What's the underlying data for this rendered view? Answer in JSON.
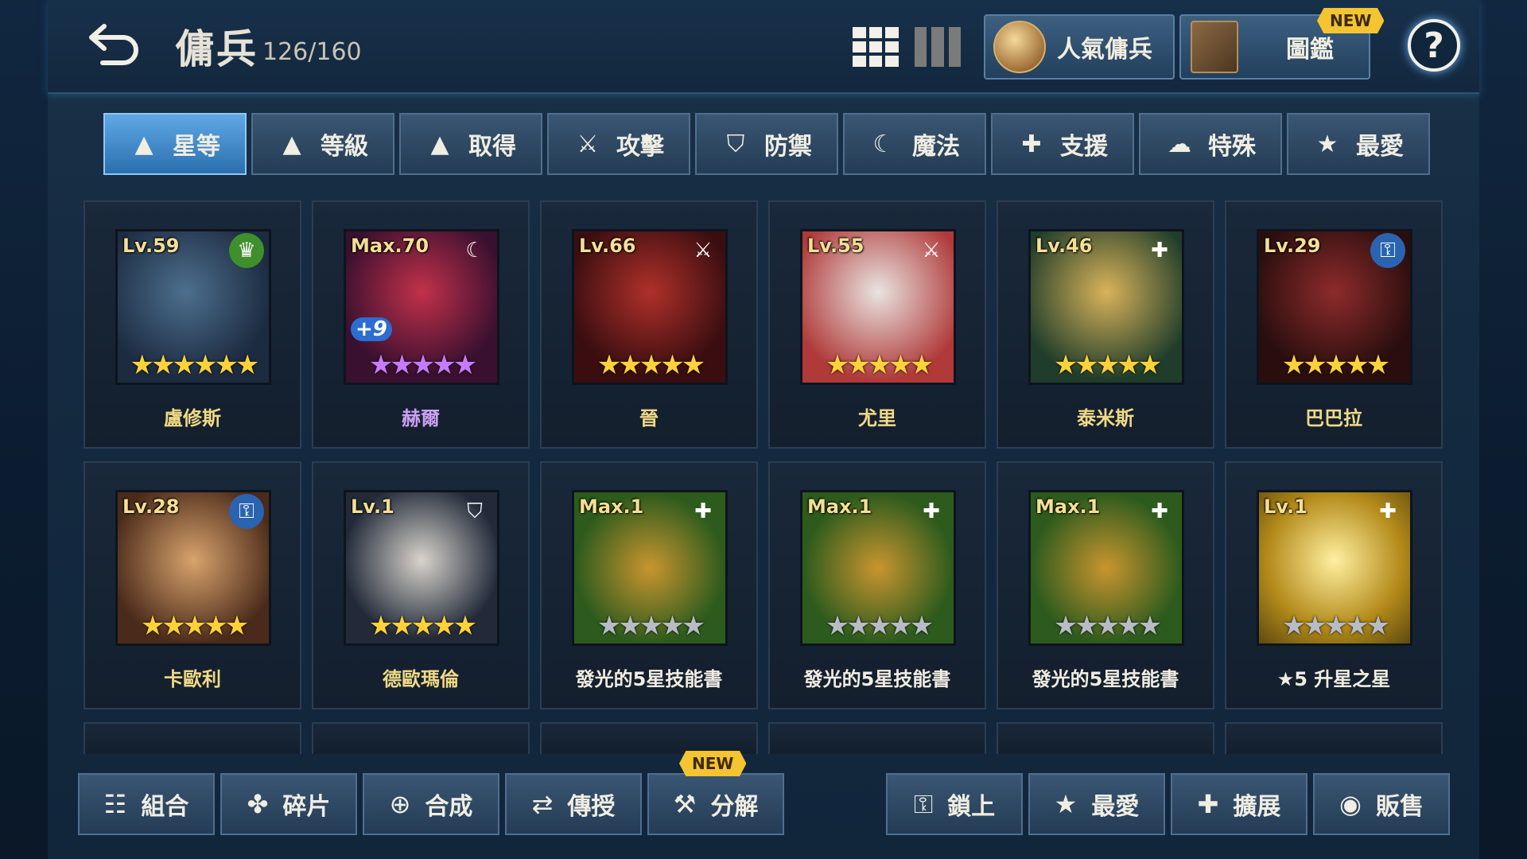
{
  "header": {
    "title": "傭兵",
    "count": "126/160",
    "popular_label": "人氣傭兵",
    "dex_label": "圖鑑",
    "dex_badge": "NEW"
  },
  "sort_tabs": [
    {
      "label": "星等",
      "icon": "arrow-up-icon",
      "active": true
    },
    {
      "label": "等級",
      "icon": "arrow-up-icon"
    },
    {
      "label": "取得",
      "icon": "arrow-up-icon"
    },
    {
      "label": "攻擊",
      "icon": "sword-icon"
    },
    {
      "label": "防禦",
      "icon": "shield-icon"
    },
    {
      "label": "魔法",
      "icon": "magic-icon"
    },
    {
      "label": "支援",
      "icon": "support-icon"
    },
    {
      "label": "特殊",
      "icon": "special-icon"
    },
    {
      "label": "最愛",
      "icon": "star-icon"
    }
  ],
  "units": [
    {
      "level": "Lv.59",
      "name": "盧修斯",
      "stars": "★★★★★★",
      "star_color": "gold",
      "role": "crown-icon",
      "name_color": "gold"
    },
    {
      "level": "Max.70",
      "name": "赫爾",
      "stars": "★★★★★",
      "star_color": "purple",
      "role": "magic-icon",
      "plus": "+9",
      "name_color": "purple"
    },
    {
      "level": "Lv.66",
      "name": "晉",
      "stars": "★★★★★",
      "star_color": "gold",
      "role": "sword-icon",
      "name_color": "gold"
    },
    {
      "level": "Lv.55",
      "name": "尤里",
      "stars": "★★★★★",
      "star_color": "gold",
      "role": "sword-icon",
      "name_color": "gold"
    },
    {
      "level": "Lv.46",
      "name": "泰米斯",
      "stars": "★★★★★",
      "star_color": "gold",
      "role": "support-icon",
      "name_color": "gold"
    },
    {
      "level": "Lv.29",
      "name": "巴巴拉",
      "stars": "★★★★★",
      "star_color": "gold",
      "role": "lock-icon",
      "name_color": "gold"
    },
    {
      "level": "Lv.28",
      "name": "卡歐利",
      "stars": "★★★★★",
      "star_color": "gold",
      "role": "lock-icon",
      "name_color": "gold"
    },
    {
      "level": "Lv.1",
      "name": "德歐瑪倫",
      "stars": "★★★★★",
      "star_color": "gold",
      "role": "shield-icon",
      "name_color": "gold"
    },
    {
      "level": "Max.1",
      "name": "發光的5星技能書",
      "stars": "★★★★★",
      "star_color": "grey",
      "role": "support-icon",
      "name_color": "white"
    },
    {
      "level": "Max.1",
      "name": "發光的5星技能書",
      "stars": "★★★★★",
      "star_color": "grey",
      "role": "support-icon",
      "name_color": "white"
    },
    {
      "level": "Max.1",
      "name": "發光的5星技能書",
      "stars": "★★★★★",
      "star_color": "grey",
      "role": "support-icon",
      "name_color": "white"
    },
    {
      "level": "Lv.1",
      "name": "★5 升星之星",
      "stars": "★★★★★",
      "star_color": "grey",
      "role": "support-icon",
      "name_color": "white"
    }
  ],
  "bottom_left": [
    {
      "label": "組合",
      "icon": "team-icon"
    },
    {
      "label": "碎片",
      "icon": "puzzle-icon"
    },
    {
      "label": "合成",
      "icon": "merge-icon"
    },
    {
      "label": "傳授",
      "icon": "transfer-icon"
    },
    {
      "label": "分解",
      "icon": "hammer-icon",
      "badge": "NEW"
    }
  ],
  "bottom_right": [
    {
      "label": "鎖上",
      "icon": "lock-icon"
    },
    {
      "label": "最愛",
      "icon": "star-icon"
    },
    {
      "label": "擴展",
      "icon": "plus-icon"
    },
    {
      "label": "販售",
      "icon": "coin-icon"
    }
  ],
  "colors": {
    "gold": "#ffd23a",
    "purple": "#c67bff",
    "active_tab": "#4a93d4"
  }
}
